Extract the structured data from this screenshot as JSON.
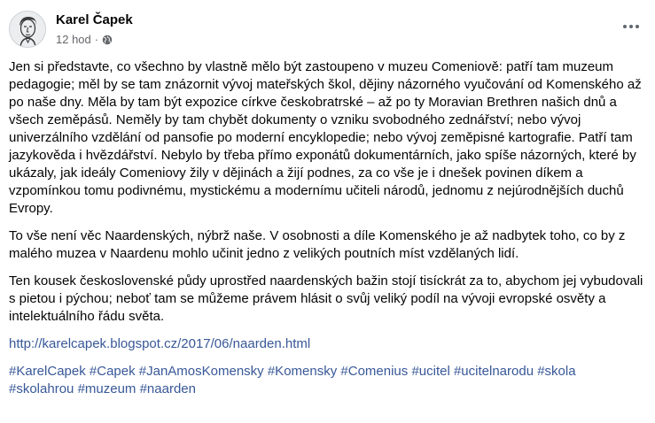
{
  "post": {
    "author": "Karel Čapek",
    "time": "12 hod",
    "separator": "·",
    "privacy_icon": "globe-icon",
    "more_icon": "more-horizontal-icon",
    "paragraphs": [
      "Jen si představte, co všechno by vlastně mělo být zastoupeno v muzeu Comeniově: patří tam muzeum pedagogie; měl by se tam znázornit vývoj mateřských škol, dějiny názorného vyučování od Komenského až po naše dny. Měla by tam být expozice církve českobratrské – až po ty Moravian Brethren našich dnů a všech zeměpásů. Neměly by tam chybět dokumenty o vzniku svobodného zednářství; nebo vývoj univerzálního vzdělání od pansofie po moderní encyklopedie; nebo vývoj zeměpisné kartografie. Patří tam jazykověda i hvězdářství. Nebylo by třeba přímo exponátů dokumentárních, jako spíše názorných, které by ukázaly, jak ideály Comeniovy žily v dějinách a žijí podnes, za co vše je i dnešek povinen díkem a vzpomínkou tomu podivnému, mystickému a modernímu učiteli národů, jednomu z nejúrodnějších duchů Evropy.",
      "To vše není věc Naardenských, nýbrž naše. V osobnosti a díle Komenského je až nadbytek toho, co by z malého muzea v Naardenu mohlo učinit jedno z velikých poutních míst vzdělaných lidí.",
      "Ten kousek československé půdy uprostřed naardenských bažin stojí tisíckrát za to, abychom jej vybudovali s pietou i pýchou; neboť tam se můžeme právem hlásit o svůj veliký podíl na vývoji evropské osvěty a intelektuálního řádu světa."
    ],
    "link": "http://karelcapek.blogspot.cz/2017/06/naarden.html",
    "hashtags": [
      "#KarelCapek",
      "#Capek",
      "#JanAmosKomensky",
      "#Komensky",
      "#Comenius",
      "#ucitel",
      "#ucitelnarodu",
      "#skola",
      "#skolahrou",
      "#muzeum",
      "#naarden"
    ],
    "colors": {
      "text": "#050505",
      "meta": "#65676b",
      "link": "#385898"
    }
  }
}
